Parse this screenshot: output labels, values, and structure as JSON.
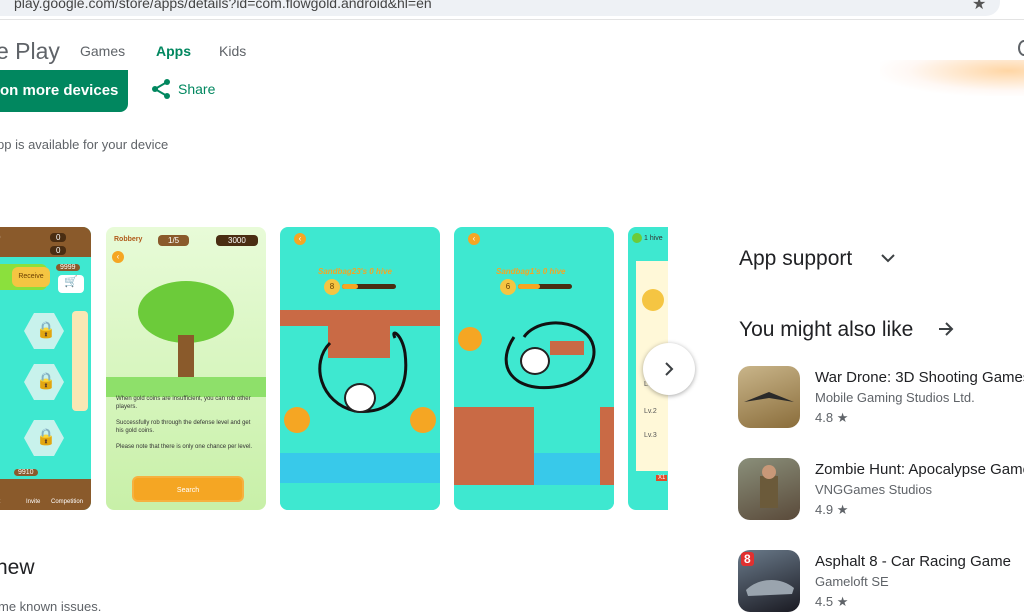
{
  "browser": {
    "url": "play.google.com/store/apps/details?id=com.flowgold.android&hl=en"
  },
  "nav": {
    "brand": "e Play",
    "tabs": [
      "Games",
      "Apps",
      "Kids"
    ],
    "active_tab": "Apps"
  },
  "actions": {
    "install_label": "on more devices",
    "share_label": "Share"
  },
  "availability": "pp is available for your device",
  "screenshots": {
    "shot1": {
      "top_values": [
        "0",
        "0",
        "0",
        "9999"
      ],
      "receive_label": "Receive",
      "bottom_labels": [
        "ent",
        "Invite",
        "Competition"
      ],
      "coin_value": "9910"
    },
    "shot2": {
      "player_name": "Robbery",
      "progress": "1/5",
      "coins": "3000",
      "text1": "When gold coins are insufficient, you can rob other players.",
      "text2": "Successfully rob through the defense level and get his gold coins.",
      "text3": "Please note that there is only one chance per level.",
      "search_label": "Search"
    },
    "shot3": {
      "hive_title": "Sandbag23's 0 hive",
      "level_badge": "8"
    },
    "shot4": {
      "hive_title": "Sandbag1's 0 hive",
      "level_badge": "6"
    },
    "shot5": {
      "header": "1 hive",
      "levels": [
        "Lv.1",
        "Lv.2",
        "Lv.3"
      ],
      "badge": "X1"
    }
  },
  "right_panel": {
    "app_support": "App support",
    "you_might_like": "You might also like",
    "apps": [
      {
        "name": "War Drone: 3D Shooting Games",
        "developer": "Mobile Gaming Studios Ltd.",
        "rating": "4.8"
      },
      {
        "name": "Zombie Hunt: Apocalypse Game",
        "developer": "VNGGames Studios",
        "rating": "4.9"
      },
      {
        "name": "Asphalt 8 - Car Racing Game",
        "developer": "Gameloft SE",
        "rating": "4.5"
      }
    ]
  },
  "whats_new": {
    "title": "new",
    "text": "me known issues."
  },
  "colors": {
    "accent": "#01875f",
    "teal": "#3ee8d0",
    "sky": "#38c9ea"
  }
}
